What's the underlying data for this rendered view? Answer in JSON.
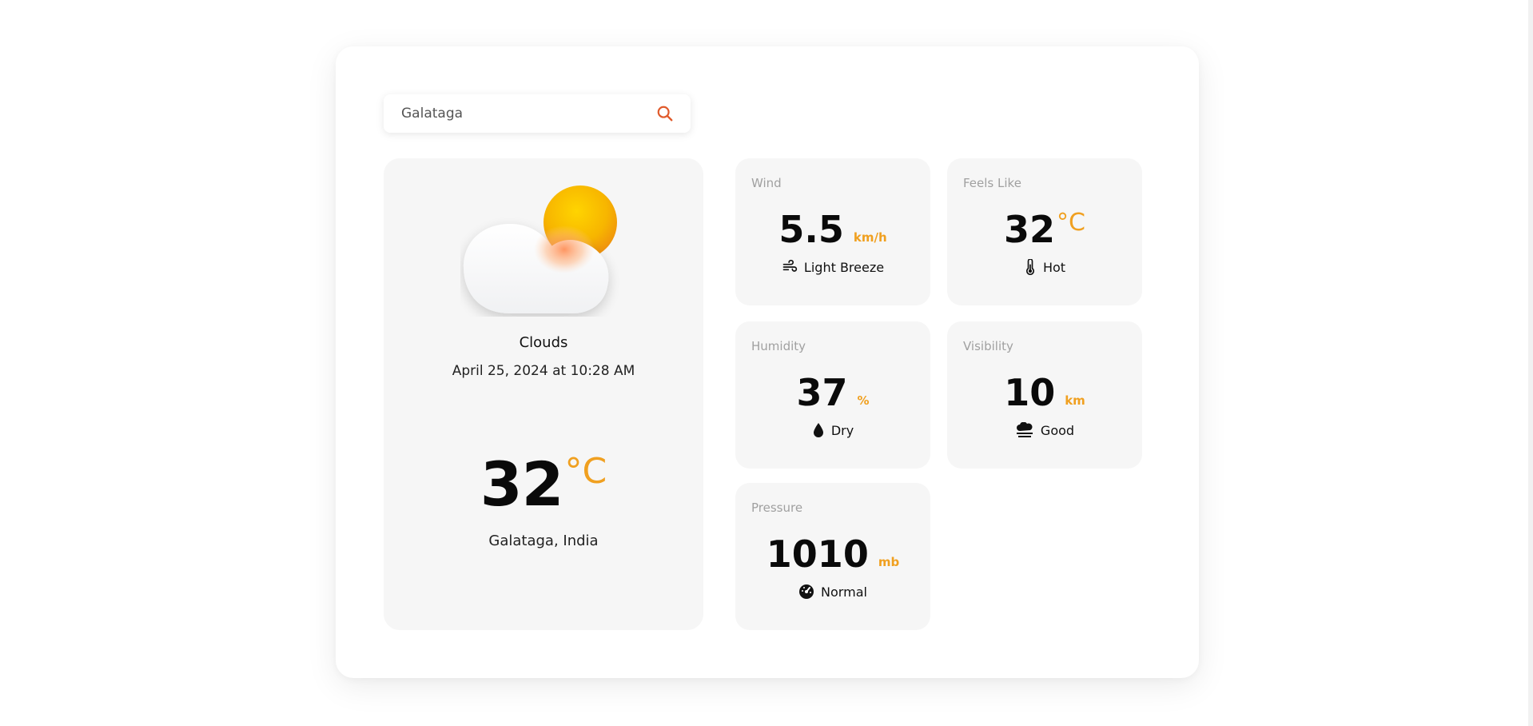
{
  "search": {
    "value": "Galataga",
    "icon": "search-icon",
    "accent_color": "#e05a2b"
  },
  "current": {
    "condition": "Clouds",
    "datetime": "April 25, 2024 at 10:28 AM",
    "temperature": "32",
    "temperature_unit": "°C",
    "location": "Galataga, India",
    "icon": "sun-cloud-icon"
  },
  "stats": {
    "wind": {
      "label": "Wind",
      "value": "5.5",
      "unit": "km/h",
      "description": "Light Breeze",
      "icon": "wind-icon"
    },
    "feels_like": {
      "label": "Feels Like",
      "value": "32",
      "unit": "°C",
      "description": "Hot",
      "icon": "thermometer-icon"
    },
    "humidity": {
      "label": "Humidity",
      "value": "37",
      "unit": "%",
      "description": "Dry",
      "icon": "water-drop-icon"
    },
    "visibility": {
      "label": "Visibility",
      "value": "10",
      "unit": "km",
      "description": "Good",
      "icon": "fog-icon"
    },
    "pressure": {
      "label": "Pressure",
      "value": "1010",
      "unit": "mb",
      "description": "Normal",
      "icon": "gauge-icon"
    }
  },
  "colors": {
    "accent": "#f0a020",
    "card_background": "#f6f6f6",
    "label_gray": "#a0a0a0"
  }
}
